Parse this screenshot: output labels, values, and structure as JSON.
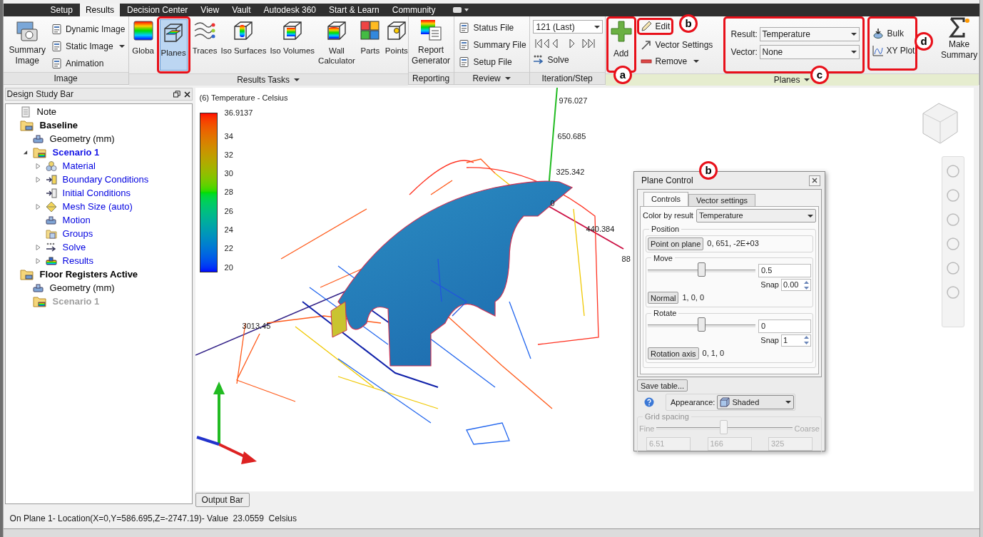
{
  "ribbon_tabs": [
    {
      "label": "Setup",
      "selected": false
    },
    {
      "label": "Results",
      "selected": true
    },
    {
      "label": "Decision Center",
      "selected": false
    },
    {
      "label": "View",
      "selected": false
    },
    {
      "label": "Vault",
      "selected": false
    },
    {
      "label": "Autodesk 360",
      "selected": false
    },
    {
      "label": "Start & Learn",
      "selected": false
    },
    {
      "label": "Community",
      "selected": false
    }
  ],
  "ribbon_groups": [
    {
      "kind": "image",
      "title": "Image",
      "has_menu": false,
      "contextual": false,
      "large": "Summary Image",
      "items": [
        {
          "label": "Dynamic Image",
          "menu": false
        },
        {
          "label": "Static Image",
          "menu": true
        },
        {
          "label": "Animation",
          "menu": false
        }
      ]
    },
    {
      "kind": "tasks",
      "title": "Results Tasks",
      "has_menu": true,
      "contextual": false,
      "tools": [
        {
          "label": "Globa",
          "selected": false
        },
        {
          "label": "Planes",
          "selected": true
        },
        {
          "label": "Traces",
          "selected": false
        },
        {
          "label": "Iso Surfaces",
          "selected": false
        },
        {
          "label": "Iso Volumes",
          "selected": false
        },
        {
          "label": "Wall Calculator",
          "selected": false
        },
        {
          "label": "Parts",
          "selected": false
        },
        {
          "label": "Points",
          "selected": false
        }
      ]
    },
    {
      "kind": "reporting",
      "title": "Reporting",
      "has_menu": false,
      "contextual": false,
      "tool": "Report Generator"
    },
    {
      "kind": "review",
      "title": "Review",
      "has_menu": true,
      "contextual": false,
      "items": [
        "Status File",
        "Summary File",
        "Setup File"
      ]
    },
    {
      "kind": "iteration",
      "title": "Iteration/Step",
      "has_menu": false,
      "contextual": false,
      "step": "121 (Last)",
      "solve": "Solve"
    },
    {
      "kind": "planes",
      "title": "Planes",
      "has_menu": true,
      "contextual": true,
      "add": "Add",
      "edit": "Edit",
      "vector_settings": "Vector Settings",
      "remove": "Remove",
      "result_label": "Result:",
      "result": "Temperature",
      "vector_label": "Vector:",
      "vector": "None",
      "bulk": "Bulk",
      "xy_plot": "XY Plot",
      "make_summary": "Make Summary"
    }
  ],
  "callouts": [
    {
      "letter": "a"
    },
    {
      "letter": "b"
    },
    {
      "letter": "c"
    },
    {
      "letter": "d"
    },
    {
      "letter": "b"
    }
  ],
  "design_study_bar": {
    "title": "Design Study Bar",
    "tree": [
      {
        "label": "Note",
        "kind": "note"
      },
      {
        "label": "Baseline",
        "kind": "design",
        "children": [
          {
            "label": "Geometry (mm)",
            "kind": "geometry"
          },
          {
            "label": "Scenario 1",
            "kind": "scenario",
            "active": true,
            "expanded": true,
            "children": [
              {
                "label": "Material",
                "kind": "material",
                "expanded": false
              },
              {
                "label": "Boundary Conditions",
                "kind": "boundary",
                "expanded": false
              },
              {
                "label": "Initial Conditions",
                "kind": "initial"
              },
              {
                "label": "Mesh Size (auto)",
                "kind": "mesh",
                "expanded": false
              },
              {
                "label": "Motion",
                "kind": "motion"
              },
              {
                "label": "Groups",
                "kind": "groups"
              },
              {
                "label": "Solve",
                "kind": "solve",
                "expanded": false
              },
              {
                "label": "Results",
                "kind": "results",
                "expanded": false
              }
            ]
          }
        ]
      },
      {
        "label": "Floor Registers Active",
        "kind": "design",
        "children": [
          {
            "label": "Geometry (mm)",
            "kind": "geometry"
          },
          {
            "label": "Scenario 1",
            "kind": "scenario",
            "active": false
          }
        ]
      }
    ]
  },
  "viewport": {
    "legend_title": "(6) Temperature - Celsius",
    "legend_max": "36.9137",
    "legend_ticks": [
      "34",
      "32",
      "30",
      "28",
      "26",
      "24",
      "22",
      "20"
    ],
    "axis_labels": [
      "976.027",
      "650.685",
      "325.342",
      "0",
      "440.384",
      "88",
      "3013.45"
    ]
  },
  "plane_control": {
    "title": "Plane Control",
    "tabs": [
      {
        "label": "Controls",
        "selected": true
      },
      {
        "label": "Vector settings",
        "selected": false
      }
    ],
    "color_by_label": "Color by result",
    "color_by": "Temperature",
    "position_label": "Position",
    "point_button": "Point on plane",
    "point_value": "0, 651, -2E+03",
    "move": {
      "label": "Move",
      "level": 0.5,
      "value": "0.5",
      "snap_label": "Snap",
      "snap": "0.00"
    },
    "normal_button": "Normal",
    "normal_value": "1, 0, 0",
    "rotate": {
      "label": "Rotate",
      "level": 0.5,
      "value": "0",
      "snap_label": "Snap",
      "snap": "1"
    },
    "rotation_axis_button": "Rotation axis",
    "rotation_axis_value": "0, 1, 0",
    "save_table": "Save table...",
    "appearance_label": "Appearance:",
    "appearance": "Shaded",
    "grid": {
      "label": "Grid spacing",
      "disabled": true,
      "fine": "Fine",
      "coarse": "Coarse",
      "level": 0.5,
      "values": [
        "6.51",
        "166",
        "325"
      ]
    }
  },
  "output_bar": "Output Bar",
  "status": "On Plane 1- Location(X=0,Y=586.695,Z=-2747.19)- Value  23.0559  Celsius"
}
